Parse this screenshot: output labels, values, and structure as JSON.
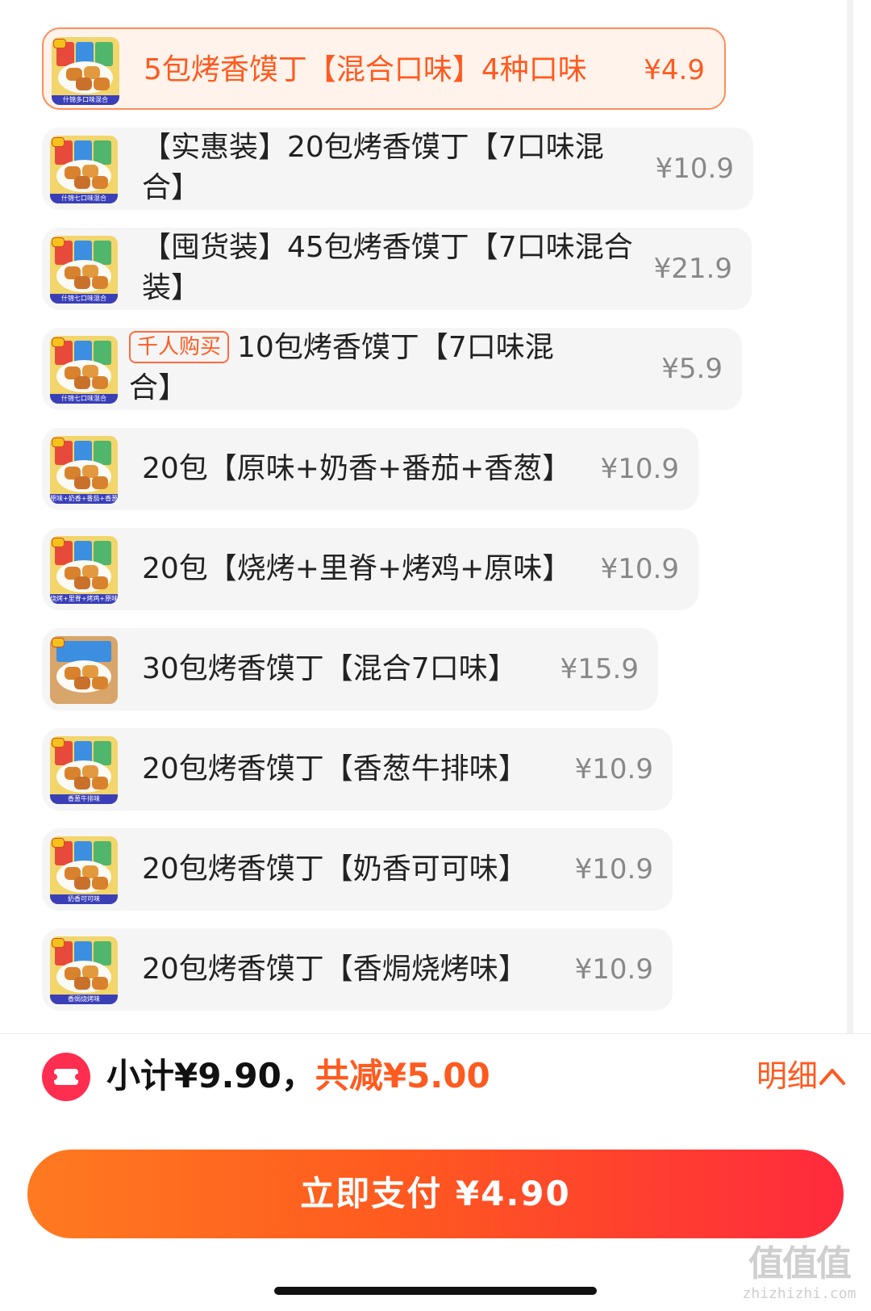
{
  "skus": [
    {
      "title": "5包烤香馍丁【混合口味】4种口味",
      "price": "¥4.9",
      "selected": true,
      "thumb_band": "什锦多口味混合"
    },
    {
      "title": "【实惠装】20包烤香馍丁【7口味混合】",
      "price": "¥10.9",
      "thumb_band": "什锦七口味混合"
    },
    {
      "title": "【囤货装】45包烤香馍丁【7口味混合装】",
      "price": "¥21.9",
      "thumb_band": "什锦七口味混合"
    },
    {
      "tag": "千人购买",
      "title": "10包烤香馍丁【7口味混合】",
      "price": "¥5.9",
      "thumb_band": "什锦七口味混合"
    },
    {
      "title": "20包【原味+奶香+番茄+香葱】",
      "price": "¥10.9",
      "thumb_band": "原味+奶香+番茄+香葱"
    },
    {
      "title": "20包【烧烤+里脊+烤鸡+原味】",
      "price": "¥10.9",
      "thumb_band": "烧烤+里脊+烤鸡+原味"
    },
    {
      "title": "30包烤香馍丁【混合7口味】",
      "price": "¥15.9",
      "thumb_band": ""
    },
    {
      "title": "20包烤香馍丁【香葱牛排味】",
      "price": "¥10.9",
      "thumb_band": "香葱牛排味"
    },
    {
      "title": "20包烤香馍丁【奶香可可味】",
      "price": "¥10.9",
      "thumb_band": "奶香可可味"
    },
    {
      "title": "20包烤香馍丁【香焗烧烤味】",
      "price": "¥10.9",
      "thumb_band": "香焗烧烤味"
    }
  ],
  "summary": {
    "subtotal": "小计¥9.90，",
    "discount": "共减¥5.00",
    "detail_label": "明细"
  },
  "pay_button": {
    "label": "立即支付 ¥4.90"
  },
  "watermark": {
    "mark": "值值值",
    "url": "zhizhizhi.com"
  },
  "colors": {
    "accent": "#ff5a1f",
    "selected_bg": "#fff3ec",
    "coupon_icon": "#ff2d4f"
  }
}
